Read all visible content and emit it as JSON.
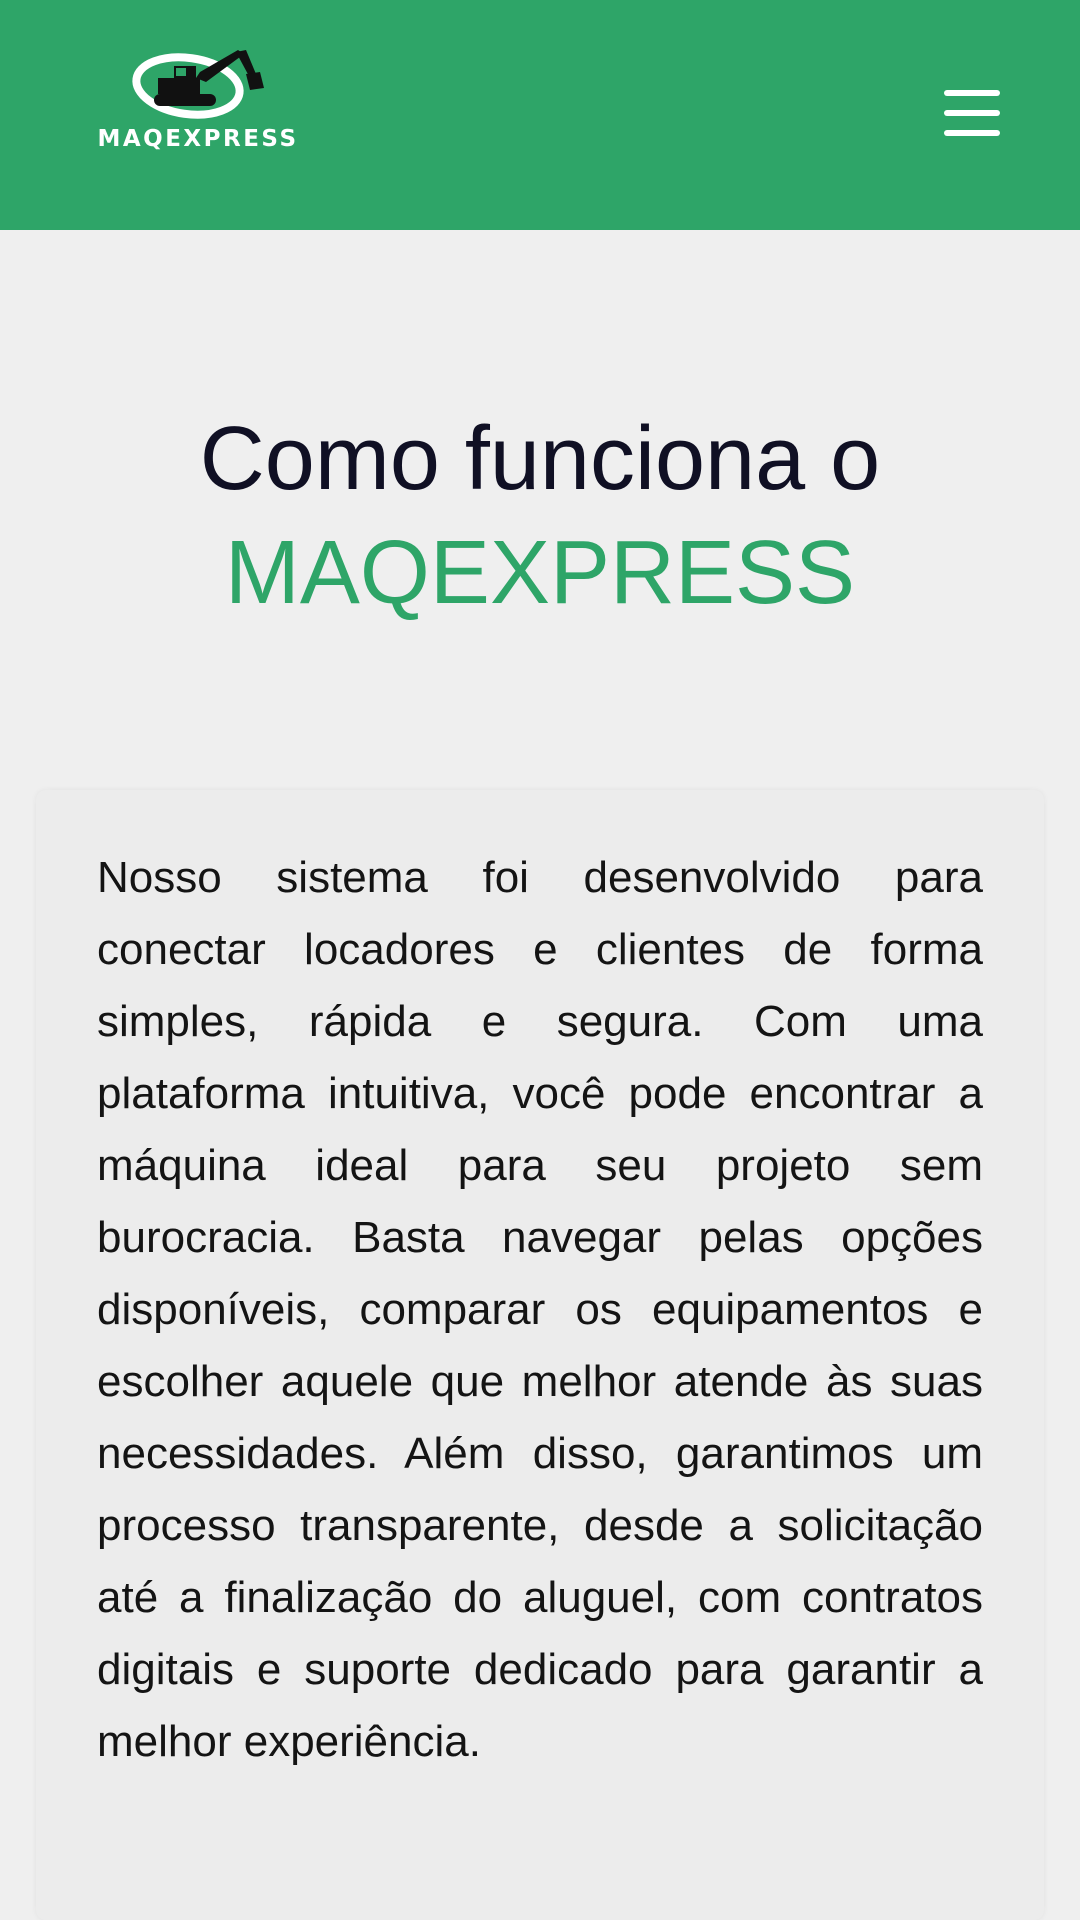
{
  "header": {
    "logo_text": "MAQEXPRESS",
    "menu_icon": "hamburger-menu-icon",
    "background_color": "#2ea568"
  },
  "hero": {
    "title_line1": "Como funciona o",
    "title_line2": "MAQEXPRESS",
    "accent_color": "#2ea568"
  },
  "content": {
    "paragraph": "Nosso sistema foi desenvolvido para conectar locadores e clientes de forma simples, rápida e segura. Com uma plataforma intuitiva, você pode encontrar a máquina ideal para seu projeto sem burocracia. Basta navegar pelas opções disponíveis, comparar os equipamentos e escolher aquele que melhor atende às suas necessidades. Além disso, garantimos um processo transparente, desde a solicitação até a finalização do aluguel, com contratos digitais e suporte dedicado para garantir a melhor experiência."
  }
}
